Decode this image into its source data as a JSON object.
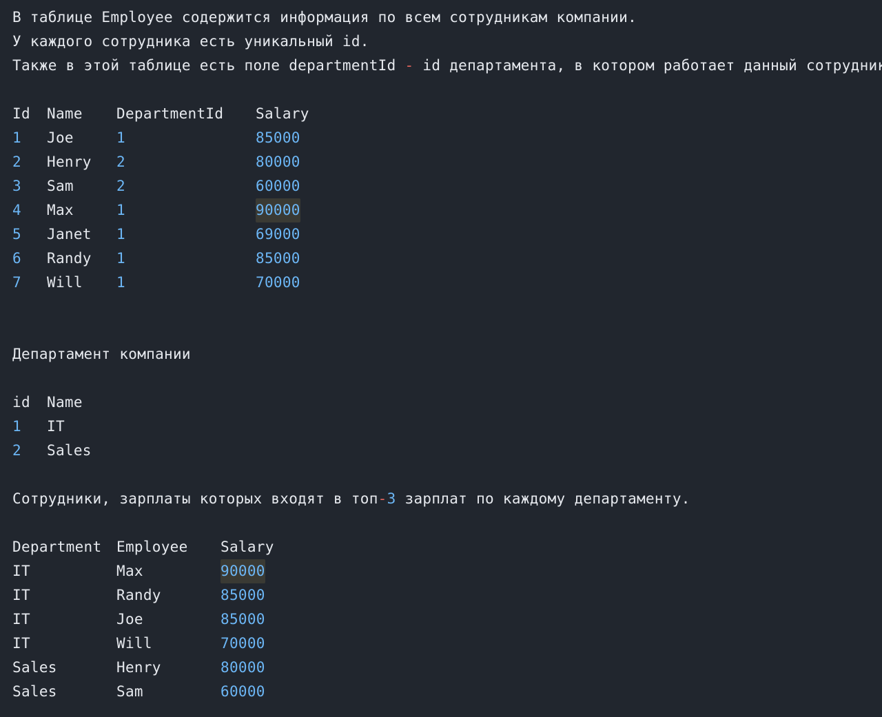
{
  "intro": {
    "line1": "В таблице Employee содержится информация по всем сотрудникам компании.",
    "line2": "У каждого сотрудника есть уникальный id.",
    "line3_before": "Также в этой таблице есть поле departmentId ",
    "line3_dash": "-",
    "line3_after": " id департамента, в котором работает данный сотрудник."
  },
  "employee_table": {
    "headers": [
      "Id",
      "Name",
      "DepartmentId",
      "Salary"
    ],
    "rows": [
      {
        "id": "1",
        "name": "Joe",
        "department_id": "1",
        "salary": "85000"
      },
      {
        "id": "2",
        "name": "Henry",
        "department_id": "2",
        "salary": "80000"
      },
      {
        "id": "3",
        "name": "Sam",
        "department_id": "2",
        "salary": "60000"
      },
      {
        "id": "4",
        "name": "Max",
        "department_id": "1",
        "salary": "90000"
      },
      {
        "id": "5",
        "name": "Janet",
        "department_id": "1",
        "salary": "69000"
      },
      {
        "id": "6",
        "name": "Randy",
        "department_id": "1",
        "salary": "85000"
      },
      {
        "id": "7",
        "name": "Will",
        "department_id": "1",
        "salary": "70000"
      }
    ]
  },
  "department_title": "Департамент компании",
  "department_table": {
    "headers": [
      "id",
      "Name"
    ],
    "rows": [
      {
        "id": "1",
        "name": "IT"
      },
      {
        "id": "2",
        "name": "Sales"
      }
    ]
  },
  "result_intro": {
    "before": "Сотрудники, зарплаты которых входят в топ",
    "dash": "-",
    "number": "3",
    "after": " зарплат по каждому департаменту."
  },
  "result_table": {
    "headers": [
      "Department",
      "Employee",
      "Salary"
    ],
    "rows": [
      {
        "department": "IT",
        "employee": "Max",
        "salary": "90000"
      },
      {
        "department": "IT",
        "employee": "Randy",
        "salary": "85000"
      },
      {
        "department": "IT",
        "employee": "Joe",
        "salary": "85000"
      },
      {
        "department": "IT",
        "employee": "Will",
        "salary": "70000"
      },
      {
        "department": "Sales",
        "employee": "Henry",
        "salary": "80000"
      },
      {
        "department": "Sales",
        "employee": "Sam",
        "salary": "60000"
      }
    ]
  },
  "colors": {
    "background": "#21262e",
    "text": "#e6e9ee",
    "number": "#6cb6f5",
    "operator": "#e0645c",
    "highlight": "#3a3a34"
  }
}
